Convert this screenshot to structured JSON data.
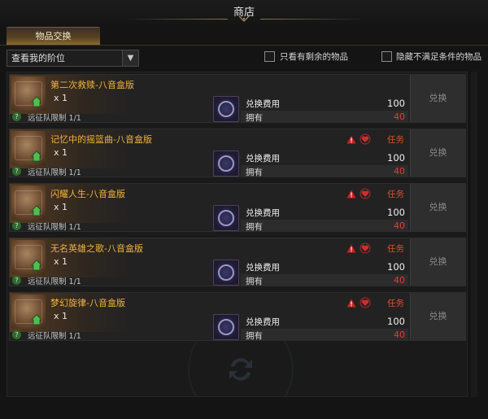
{
  "window": {
    "title": "商店"
  },
  "tabs": [
    {
      "label": "物品交换"
    }
  ],
  "filter": {
    "select_value": "查看我的阶位",
    "checkbox_remaining": {
      "label": "只看有剩余的物品",
      "checked": false
    },
    "checkbox_hide_unmet": {
      "label": "隐藏不满足条件的物品",
      "checked": false
    }
  },
  "items": [
    {
      "name": "第二次救赎-八音盒版",
      "qty": "x 1",
      "limit": "远征队限制 1/1",
      "cost_label": "兑换费用",
      "cost": "100",
      "own_label": "拥有",
      "own": "40",
      "task": "",
      "button": "兑换"
    },
    {
      "name": "记忆中的摇篮曲-八音盒版",
      "qty": "x 1",
      "limit": "远征队限制 1/1",
      "cost_label": "兑换费用",
      "cost": "100",
      "own_label": "拥有",
      "own": "40",
      "task": "任务",
      "button": "兑换"
    },
    {
      "name": "闪耀人生-八音盒版",
      "qty": "x 1",
      "limit": "远征队限制 1/1",
      "cost_label": "兑换费用",
      "cost": "100",
      "own_label": "拥有",
      "own": "40",
      "task": "任务",
      "button": "兑换"
    },
    {
      "name": "无名英雄之歌-八音盒版",
      "qty": "x 1",
      "limit": "远征队限制 1/1",
      "cost_label": "兑换费用",
      "cost": "100",
      "own_label": "拥有",
      "own": "40",
      "task": "任务",
      "button": "兑换"
    },
    {
      "name": "梦幻旋律-八音盒版",
      "qty": "x 1",
      "limit": "远征队限制 1/1",
      "cost_label": "兑换费用",
      "cost": "100",
      "own_label": "拥有",
      "own": "40",
      "task": "任务",
      "button": "兑换"
    }
  ],
  "icons": {
    "item": "music-box-icon",
    "house": "house-icon",
    "help": "question-icon",
    "currency": "emblem-currency-icon",
    "warning": "warning-icon",
    "heart": "heart-icon",
    "select_arrow": "chevron-down-icon",
    "background": "exchange-arrows-icon"
  },
  "colors": {
    "item_name": "#f0b43c",
    "own_insufficient": "#e83a3a",
    "task": "#e05030",
    "tab_active": "#8a6a2c"
  }
}
